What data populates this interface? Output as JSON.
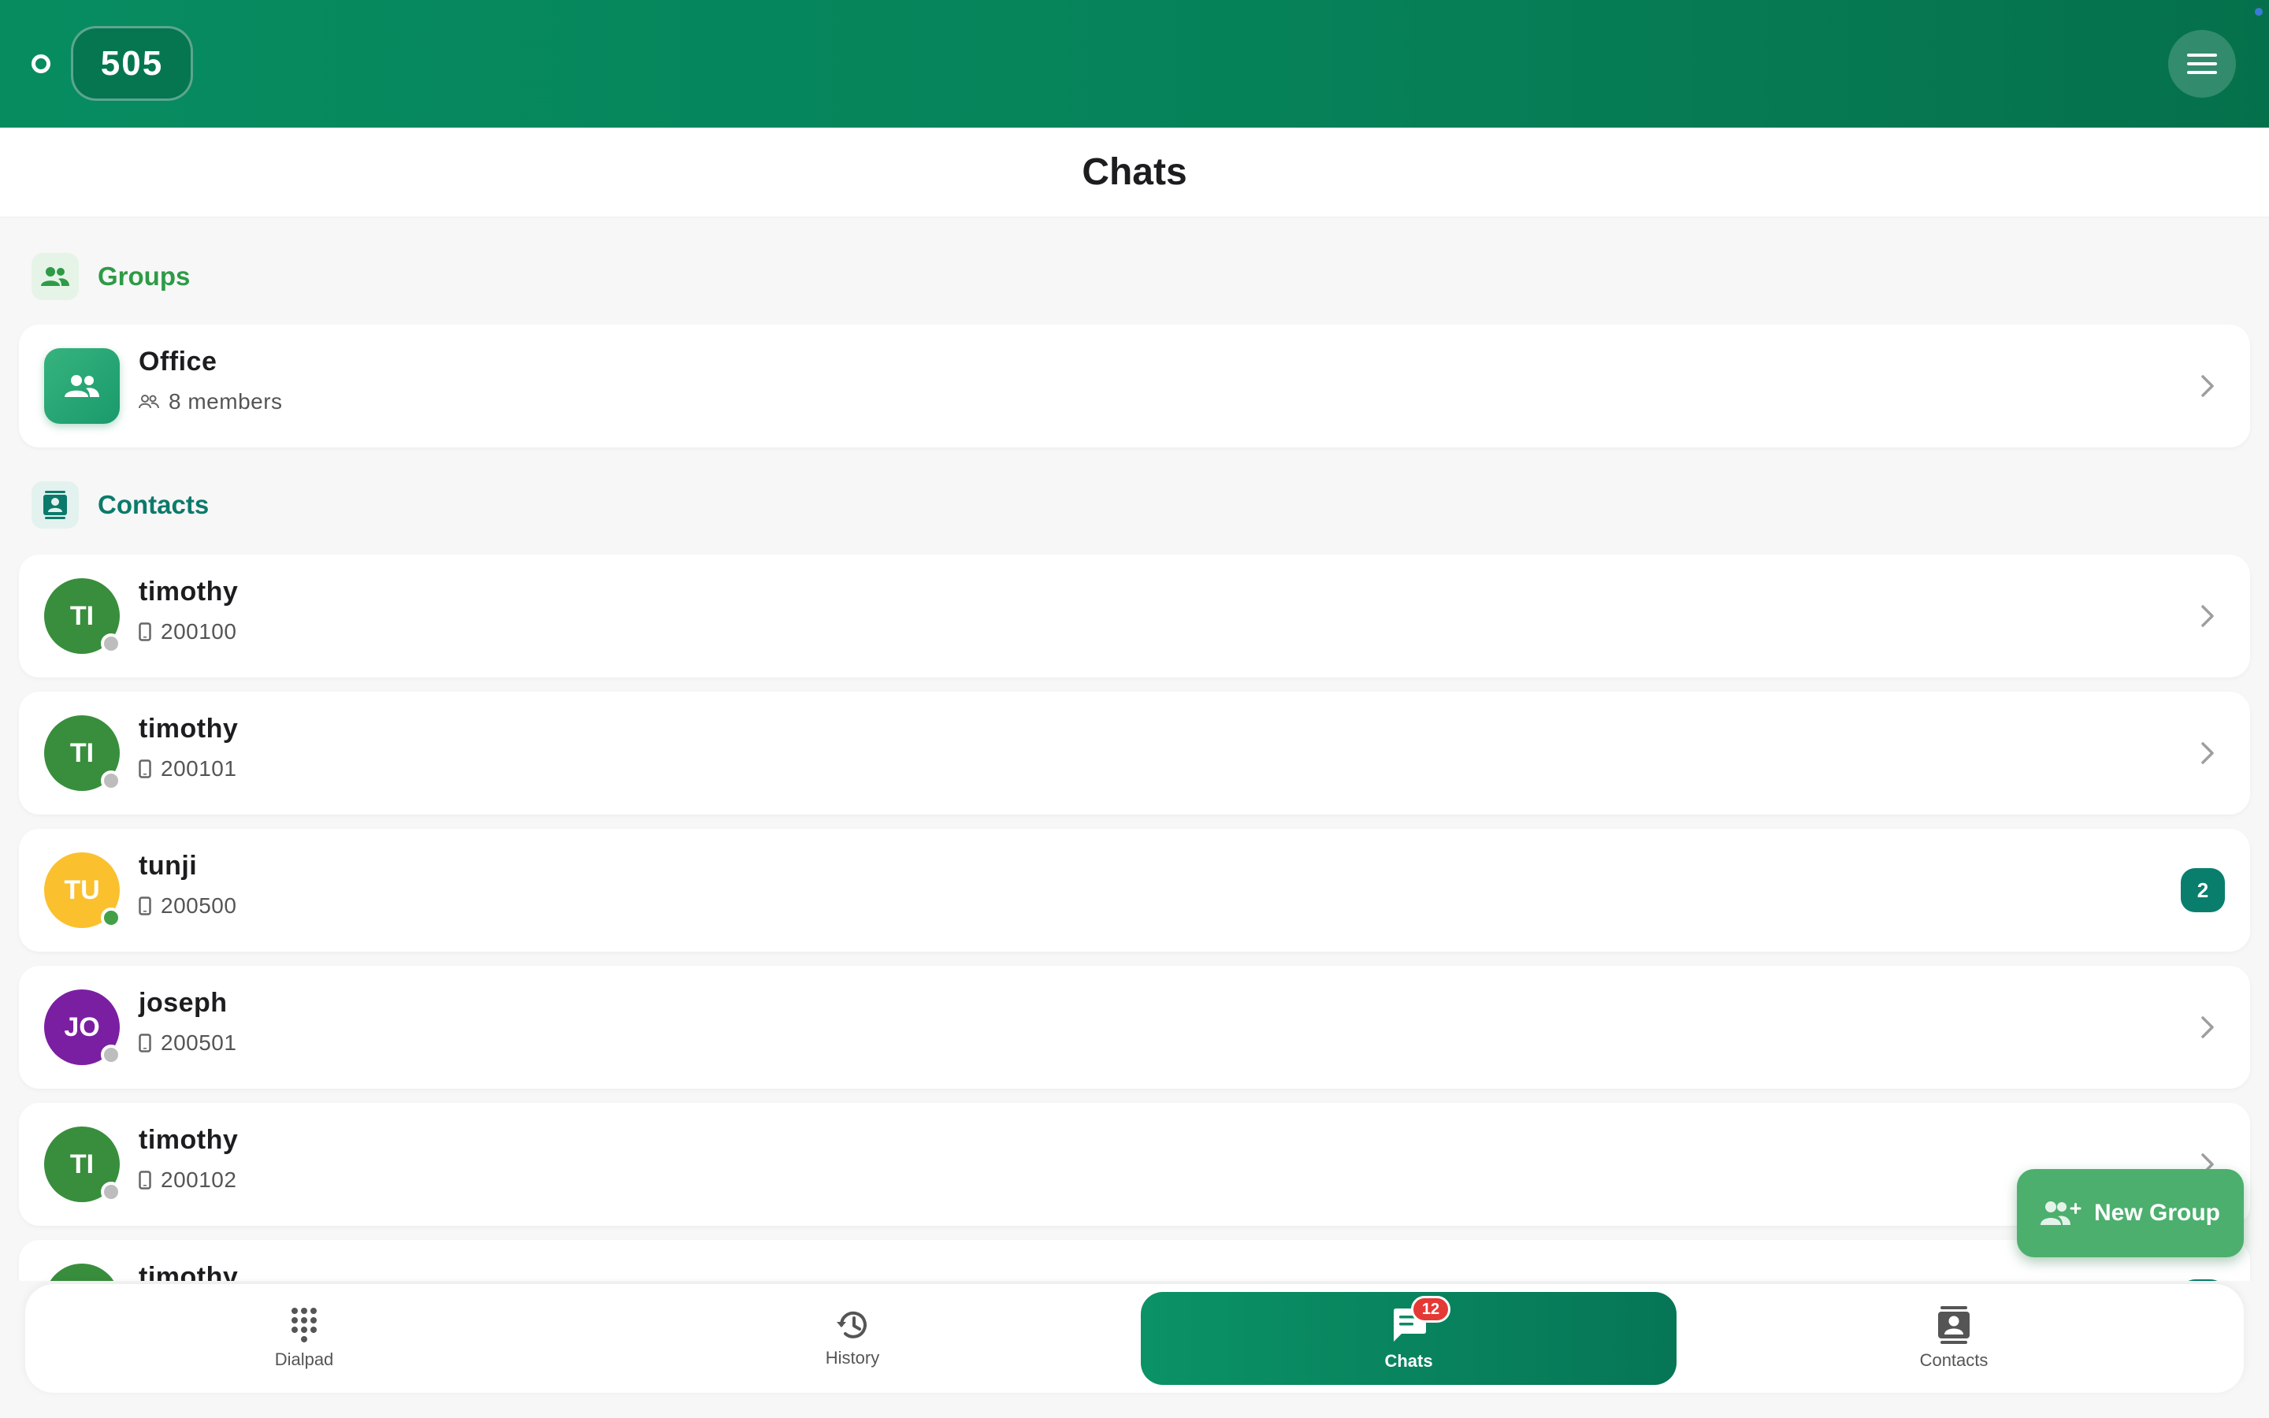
{
  "header": {
    "extension": "505",
    "status_icon": "status-ring-icon",
    "menu_icon": "hamburger-menu-icon"
  },
  "page": {
    "title": "Chats"
  },
  "groups_section": {
    "label": "Groups",
    "icon": "group-icon",
    "color": "#2e9b46"
  },
  "groups": [
    {
      "name": "Office",
      "members": "8 members",
      "icon": "group-icon"
    }
  ],
  "contacts_section": {
    "label": "Contacts",
    "icon": "contact-card-icon",
    "color": "#0c7a6a"
  },
  "contacts": [
    {
      "initials": "TI",
      "name": "timothy",
      "number": "200100",
      "color": "#388e3c",
      "presence": "offline",
      "unread": ""
    },
    {
      "initials": "TI",
      "name": "timothy",
      "number": "200101",
      "color": "#388e3c",
      "presence": "offline",
      "unread": ""
    },
    {
      "initials": "TU",
      "name": "tunji",
      "number": "200500",
      "color": "#fbc02d",
      "presence": "online",
      "unread": "2"
    },
    {
      "initials": "JO",
      "name": "joseph",
      "number": "200501",
      "color": "#7b1fa2",
      "presence": "offline",
      "unread": ""
    },
    {
      "initials": "TI",
      "name": "timothy",
      "number": "200102",
      "color": "#388e3c",
      "presence": "offline",
      "unread": ""
    },
    {
      "initials": "TI",
      "name": "timothy",
      "number": "",
      "color": "#388e3c",
      "presence": "offline",
      "unread": ""
    }
  ],
  "fab": {
    "label": "New Group",
    "icon": "add-group-icon"
  },
  "nav": {
    "items": [
      {
        "label": "Dialpad",
        "icon": "dialpad-icon"
      },
      {
        "label": "History",
        "icon": "history-icon"
      },
      {
        "label": "Chats",
        "icon": "chat-icon",
        "badge": "12",
        "active": true
      },
      {
        "label": "Contacts",
        "icon": "contacts-book-icon"
      }
    ]
  },
  "colors": {
    "brand": "#078c60",
    "online": "#43a047",
    "offline": "#bdbdbd",
    "unread_badge": "#0a7e6c",
    "nav_badge": "#e53935"
  }
}
